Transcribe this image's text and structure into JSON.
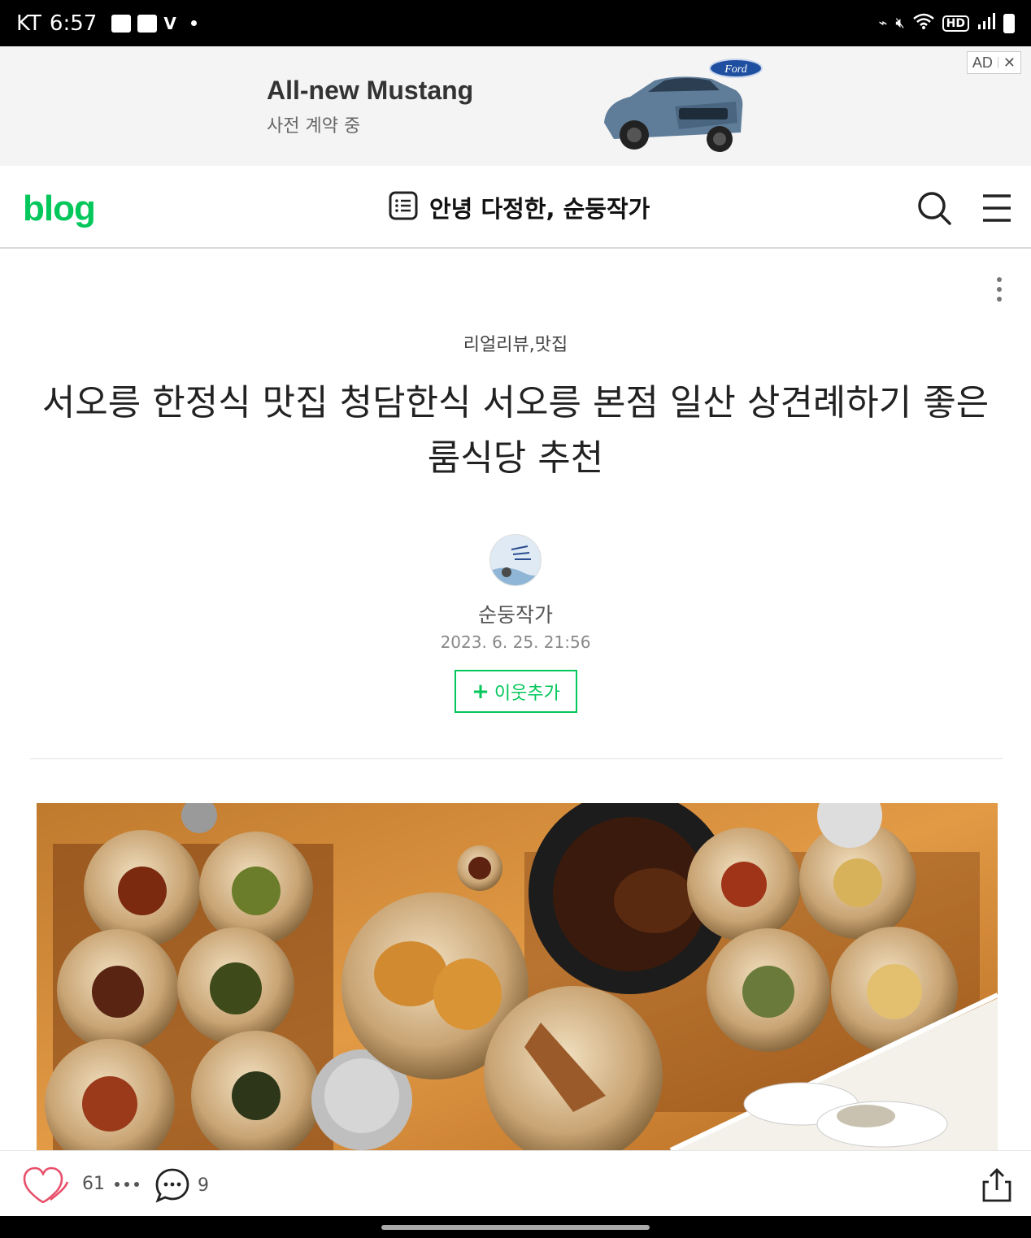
{
  "status_bar": {
    "carrier": "KT",
    "time": "6:57",
    "network": "HD"
  },
  "ad": {
    "title": "All-new Mustang",
    "subtitle": "사전 계약 중",
    "badge_label": "AD",
    "close_symbol": "✕",
    "brand_logo_text": "Ford"
  },
  "header": {
    "logo": "blog",
    "blog_title": "안녕 다정한, 순둥작가",
    "icons": [
      "list-icon",
      "search-icon",
      "menu-icon"
    ]
  },
  "post": {
    "category": "리얼리뷰,맛집",
    "title": "서오릉 한정식 맛집 청담한식 서오릉 본점 일산 상견례하기 좋은 룸식당 추천",
    "author": "순둥작가",
    "date": "2023. 6. 25. 21:56",
    "follow_label": "이웃추가",
    "follow_symbol": "+"
  },
  "actions": {
    "likes": "61",
    "comments": "9"
  },
  "colors": {
    "accent": "#03c75a",
    "status_bar": "#000000",
    "ad_background": "#f4f4f4",
    "heart": "#e8506a"
  }
}
